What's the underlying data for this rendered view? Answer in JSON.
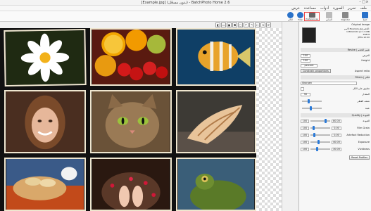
{
  "window": {
    "title": "[Example.jpg] (بدون مسجّل) - BatchPhoto Home 2.6",
    "min": "–",
    "max": "□",
    "close": "×"
  },
  "menu": [
    "ملف",
    "تحرير",
    "الصورة",
    "أدوات",
    "مساعدة",
    "عرض"
  ],
  "toolbar": {
    "save": "حفظ",
    "save_as": "Save As",
    "prev": "السابق",
    "next": "التالي",
    "preview": "Preview",
    "undo": "رجوع",
    "redo": "إعادة",
    "preferences": "Preferences",
    "register": "Register",
    "help": "Help",
    "colors": {
      "save": "#2a72c9",
      "help": "#2a72c9",
      "register": "#2b7bd0"
    }
  },
  "canvas_toolbar": [
    "◧",
    "▭",
    "▣",
    "⧉",
    "▢",
    "↶",
    "↷",
    "↔",
    "⟲",
    "⟳"
  ],
  "tiles": [
    {
      "name": "white-flower-photo",
      "bg": "#1f2a12"
    },
    {
      "name": "fruits-photo",
      "bg": "#5a1a10"
    },
    {
      "name": "tropical-fish-photo",
      "bg": "#0f3f66"
    },
    {
      "name": "smiling-woman-photo",
      "bg": "#4a2e20"
    },
    {
      "name": "cat-photo",
      "bg": "#6a5238"
    },
    {
      "name": "seashell-photo",
      "bg": "#3d3a35"
    },
    {
      "name": "bread-basket-photo",
      "bg": "#3a5a88"
    },
    {
      "name": "feet-petals-photo",
      "bg": "#2a1810"
    },
    {
      "name": "frog-photo",
      "bg": "#3a5e78"
    }
  ],
  "panel": {
    "original_image": "Original Image",
    "file_info_lines": [
      "الاسم:Example.jpg  الحجم:",
      "1280x1024 px  1.9 MB",
      "RGB:8",
      "JPEG 12:00"
    ],
    "section_resize": "Resize | تغيير الحجم",
    "width_label": "العرض",
    "width_value": "100",
    "height_label": "Height",
    "height_value": "100",
    "unit_label": "percent",
    "lock_value": "Constrain proportions",
    "aspect_label": "Aspect ratio",
    "section_filters": "Filters | فلاتر",
    "filter_select": "Sharpen",
    "sharpen_check": "تطبيق على الكل",
    "amount_label": "المقدار",
    "amount_value": "50",
    "radius_label": "نصف القطر",
    "threshold_label": "عتبة",
    "section_quality": "Quality | الجودة",
    "quality_rows": [
      {
        "label": "الجودة",
        "value": "80.00",
        "pos": 0.8
      },
      {
        "label": "Film Grain",
        "value": "0.00",
        "pos": 0.1
      },
      {
        "label": "Artefact Reduction",
        "value": "0.00",
        "pos": 0.15
      },
      {
        "label": "Exposure",
        "value": "40.00",
        "pos": 0.4
      },
      {
        "label": "Vividness",
        "value": "30.00",
        "pos": 0.3
      }
    ],
    "reset_button": "Reset Profiles",
    "zoom_min": "100",
    "zoom_max": "100"
  }
}
